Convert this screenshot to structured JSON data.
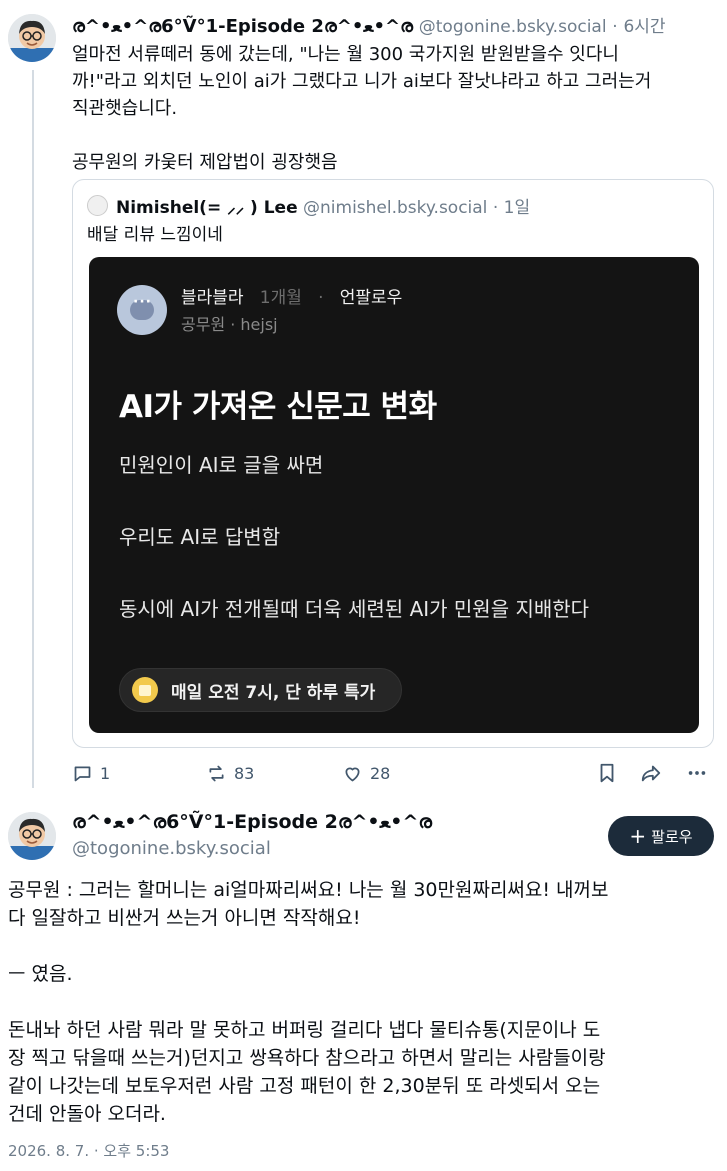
{
  "post1": {
    "author_name": "ര^•ﻌ•^ര6°Ṽ°1-Episode 2ര^•ﻌ•^ര",
    "handle": "@togonine.bsky.social",
    "time": "6시간",
    "text_lines": [
      "얼마전 서류떼러 동에 갔는데, \"나는 월 300 국가지원 받원받을수 잇다니",
      "까!\"라고 외치던 노인이 ai가 그랬다고 니가 ai보다 잘낫냐라고 하고 그러는거",
      "직관햇습니다.",
      "",
      "공무원의 카웆터 제압법이 굉장햇음"
    ],
    "quote": {
      "author_name": "Nimishel(= ⸝⸝ ) Lee",
      "handle": "@nimishel.bsky.social",
      "time": "1일",
      "text": "배달 리뷰 느낌이네",
      "embed": {
        "user_name": "블라블라",
        "user_time": "1개월",
        "unfollow": "언팔로우",
        "user_sub": "공무원 · hejsj",
        "title": "AI가 가져온 신문고 변화",
        "lines": [
          "민원인이 AI로 글을 싸면",
          "우리도 AI로 답변함",
          "동시에 AI가 전개될때 더욱 세련된 AI가 민원을 지배한다"
        ],
        "button_label": "매일 오전 7시, 단 하루 특가"
      }
    },
    "actions": {
      "reply_count": "1",
      "repost_count": "83",
      "like_count": "28"
    }
  },
  "post2": {
    "author_name": "ര^•ﻌ•^ര6°Ṽ°1-Episode 2ര^•ﻌ•^ര",
    "handle": "@togonine.bsky.social",
    "follow_label": "팔로우",
    "text_lines": [
      "공무원 : 그러는 할머니는 ai얼마짜리써요! 나는 월 30만원짜리써요! 내꺼보",
      "다 일잘하고 비싼거 쓰는거 아니면 작작해요!",
      "",
      "ㅡ 였음.",
      "",
      "돈내놔 하던 사람 뭐라 말 못하고 버퍼링 걸리다 냅다 물티슈통(지문이나 도",
      "장 찍고 닦을때 쓰는거)던지고 쌍욕하다 참으라고 하면서 말리는 사람들이랑",
      "같이 나갓는데 보토우저런 사람 고정 패턴이 한 2,30분뒤 또 라셋되서 오는",
      "건데 안돌아 오더라."
    ],
    "date": "2026. 8. 7. · 오후 5:53"
  },
  "colors": {
    "text": "#0b0f14",
    "muted": "#6f7d8b",
    "border": "#d4dbe2",
    "embed_bg": "#141414",
    "follow_btn_bg": "#1c2b3a"
  }
}
